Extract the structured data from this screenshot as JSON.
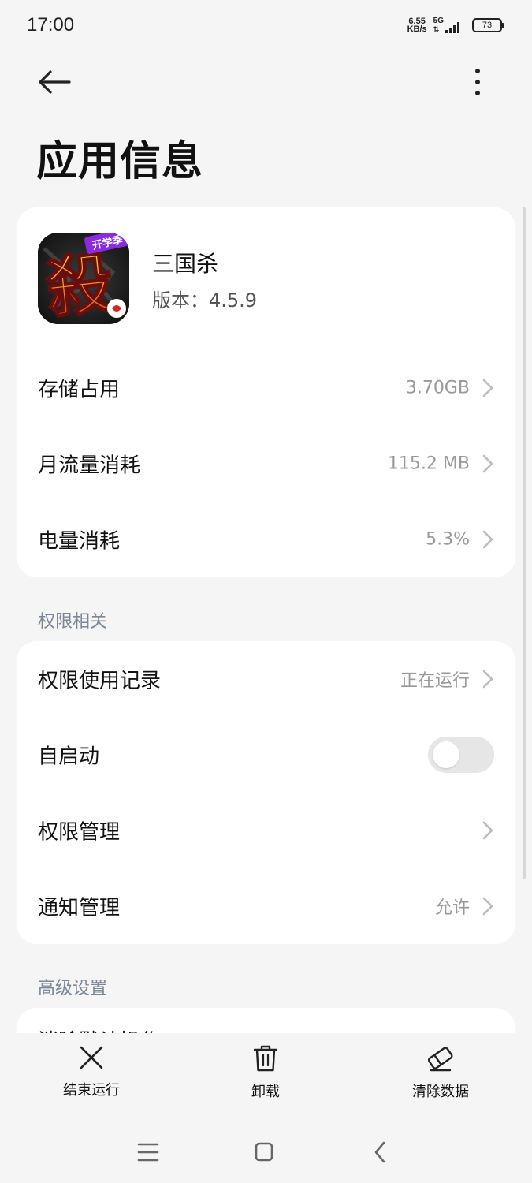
{
  "status_bar": {
    "time": "17:00",
    "net_speed_value": "6.55",
    "net_speed_unit": "KB/s",
    "network": "5G",
    "battery": "73"
  },
  "header": {
    "title": "应用信息"
  },
  "app": {
    "name": "三国杀",
    "version": "版本：4.5.9",
    "icon_badge": "开学季",
    "icon_glyph": "殺"
  },
  "usage": [
    {
      "label": "存储占用",
      "value": "3.70GB"
    },
    {
      "label": "月流量消耗",
      "value": "115.2 MB"
    },
    {
      "label": "电量消耗",
      "value": "5.3%"
    }
  ],
  "permissions_section": {
    "title": "权限相关",
    "items": [
      {
        "label": "权限使用记录",
        "value": "正在运行"
      },
      {
        "label": "自启动",
        "toggle": false
      },
      {
        "label": "权限管理",
        "value": ""
      },
      {
        "label": "通知管理",
        "value": "允许"
      }
    ]
  },
  "advanced_section": {
    "title": "高级设置",
    "partial_item": "消除默认操作"
  },
  "bottom_actions": {
    "stop": "结束运行",
    "uninstall": "卸载",
    "clear": "清除数据"
  },
  "icons": {
    "back": "arrow-left-icon",
    "more": "more-vertical-icon",
    "chevron": "chevron-right-icon",
    "stop": "close-x-icon",
    "uninstall": "trash-icon",
    "clear": "eraser-icon"
  },
  "colors": {
    "background": "#f5f5f5",
    "card": "#ffffff",
    "section_title": "#7a8797",
    "secondary_text": "#999999"
  }
}
